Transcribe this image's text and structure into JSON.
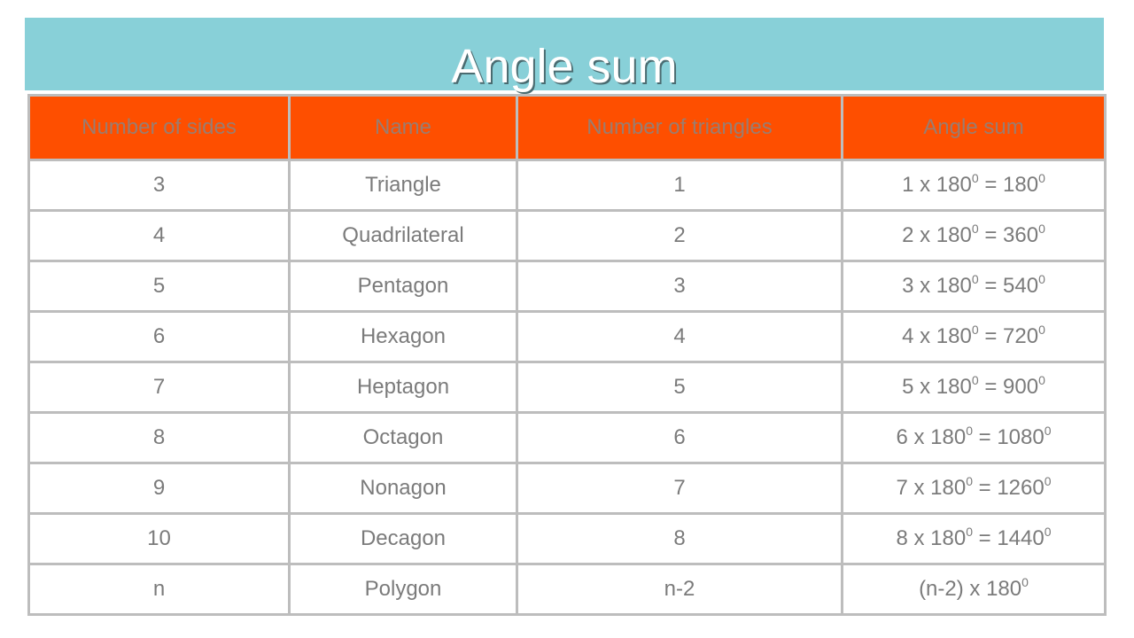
{
  "title": "Angle sum",
  "colors": {
    "title_bar": "#88d0d8",
    "header_bg": "#fe4f00",
    "header_text": "#9a7d70",
    "cell_text": "#7b7b7b",
    "border": "#bdbdbd"
  },
  "table": {
    "headers": [
      "Number of sides",
      "Name",
      "Number of triangles",
      "Angle sum"
    ],
    "rows": [
      {
        "sides": "3",
        "name": "Triangle",
        "triangles": "1",
        "angle_sum": {
          "a": "1 x 180",
          "a_sup": "0",
          "b": " = 180",
          "b_sup": "0"
        }
      },
      {
        "sides": "4",
        "name": "Quadrilateral",
        "triangles": "2",
        "angle_sum": {
          "a": "2 x 180",
          "a_sup": "0",
          "b": " = 360",
          "b_sup": "0"
        }
      },
      {
        "sides": "5",
        "name": "Pentagon",
        "triangles": "3",
        "angle_sum": {
          "a": "3 x 180",
          "a_sup": "0",
          "b": " = 540",
          "b_sup": "0"
        }
      },
      {
        "sides": "6",
        "name": "Hexagon",
        "triangles": "4",
        "angle_sum": {
          "a": "4 x 180",
          "a_sup": "0",
          "b": " = 720",
          "b_sup": "0"
        }
      },
      {
        "sides": "7",
        "name": "Heptagon",
        "triangles": "5",
        "angle_sum": {
          "a": "5 x 180",
          "a_sup": "0",
          "b": " = 900",
          "b_sup": "0"
        }
      },
      {
        "sides": "8",
        "name": "Octagon",
        "triangles": "6",
        "angle_sum": {
          "a": "6 x 180",
          "a_sup": "0",
          "b": " = 1080",
          "b_sup": "0"
        }
      },
      {
        "sides": "9",
        "name": "Nonagon",
        "triangles": "7",
        "angle_sum": {
          "a": "7 x 180",
          "a_sup": "0",
          "b": " = 1260",
          "b_sup": "0"
        }
      },
      {
        "sides": "10",
        "name": "Decagon",
        "triangles": "8",
        "angle_sum": {
          "a": "8 x 180",
          "a_sup": "0",
          "b": " = 1440",
          "b_sup": "0"
        }
      },
      {
        "sides": "n",
        "name": "Polygon",
        "triangles": "n-2",
        "angle_sum": {
          "a": "(n-2) x 180",
          "a_sup": "0",
          "b": "",
          "b_sup": ""
        }
      }
    ]
  }
}
